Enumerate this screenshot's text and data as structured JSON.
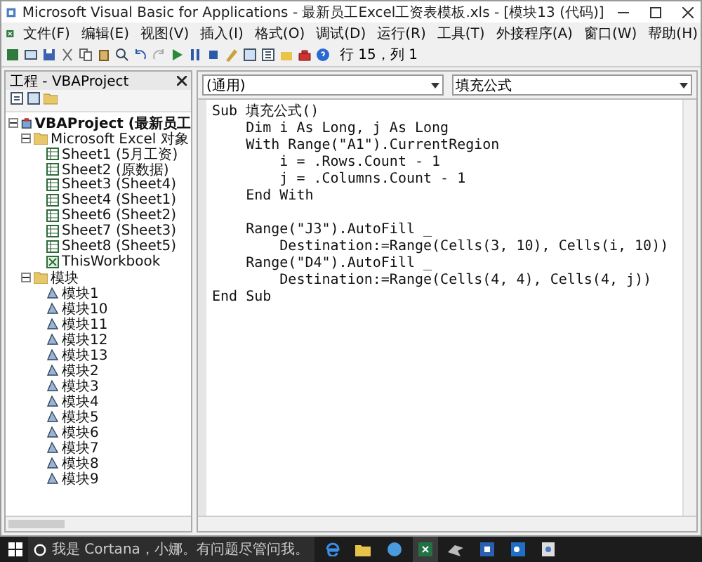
{
  "window": {
    "title": "Microsoft Visual Basic for Applications - 最新员工Excel工资表模板.xls - [模块13 (代码)]"
  },
  "menu": [
    "文件(F)",
    "编辑(E)",
    "视图(V)",
    "插入(I)",
    "格式(O)",
    "调试(D)",
    "运行(R)",
    "工具(T)",
    "外接程序(A)",
    "窗口(W)",
    "帮助(H)"
  ],
  "toolbar": {
    "position": "行 15，列 1"
  },
  "project": {
    "title": "工程 - VBAProject",
    "tree": [
      {
        "label": "VBAProject (最新员工",
        "kind": "project",
        "expanded": true,
        "children": [
          {
            "label": "Microsoft Excel 对象",
            "kind": "folder",
            "expanded": true,
            "children": [
              {
                "label": "Sheet1 (5月工资)",
                "kind": "sheet"
              },
              {
                "label": "Sheet2 (原数据)",
                "kind": "sheet"
              },
              {
                "label": "Sheet3 (Sheet4)",
                "kind": "sheet"
              },
              {
                "label": "Sheet4 (Sheet1)",
                "kind": "sheet"
              },
              {
                "label": "Sheet6 (Sheet2)",
                "kind": "sheet"
              },
              {
                "label": "Sheet7 (Sheet3)",
                "kind": "sheet"
              },
              {
                "label": "Sheet8 (Sheet5)",
                "kind": "sheet"
              },
              {
                "label": "ThisWorkbook",
                "kind": "workbook"
              }
            ]
          },
          {
            "label": "模块",
            "kind": "folder",
            "expanded": true,
            "children": [
              {
                "label": "模块1",
                "kind": "module"
              },
              {
                "label": "模块10",
                "kind": "module"
              },
              {
                "label": "模块11",
                "kind": "module"
              },
              {
                "label": "模块12",
                "kind": "module"
              },
              {
                "label": "模块13",
                "kind": "module"
              },
              {
                "label": "模块2",
                "kind": "module"
              },
              {
                "label": "模块3",
                "kind": "module"
              },
              {
                "label": "模块4",
                "kind": "module"
              },
              {
                "label": "模块5",
                "kind": "module"
              },
              {
                "label": "模块6",
                "kind": "module"
              },
              {
                "label": "模块7",
                "kind": "module"
              },
              {
                "label": "模块8",
                "kind": "module"
              },
              {
                "label": "模块9",
                "kind": "module"
              }
            ]
          }
        ]
      }
    ]
  },
  "code_window": {
    "object_dropdown": "(通用)",
    "procedure_dropdown": "填充公式",
    "blocks": [
      [
        "Sub 填充公式()",
        "    Dim i As Long, j As Long",
        "    With Range(\"A1\").CurrentRegion",
        "        i = .Rows.Count - 1",
        "        j = .Columns.Count - 1",
        "    End With"
      ],
      [
        "    Range(\"J3\").AutoFill _",
        "        Destination:=Range(Cells(3, 10), Cells(i, 10))",
        "    Range(\"D4\").AutoFill _",
        "        Destination:=Range(Cells(4, 4), Cells(4, j))",
        "End Sub"
      ]
    ]
  },
  "taskbar": {
    "search_placeholder": "我是 Cortana，小娜。有问题尽管问我。"
  }
}
